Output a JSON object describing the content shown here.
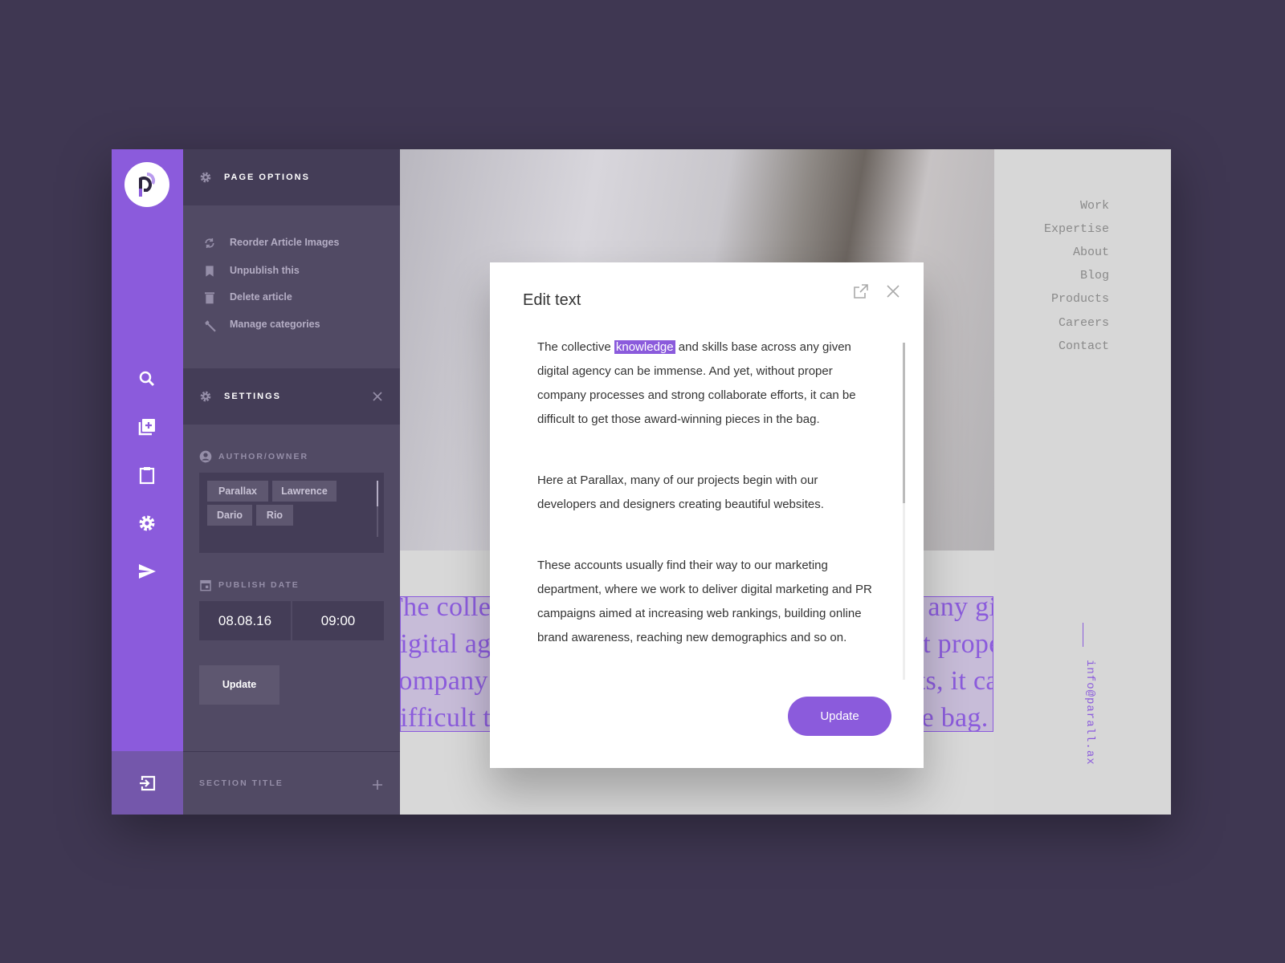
{
  "rail": {
    "brand_color": "#8b5bdc",
    "logo_letter": "P",
    "icons": [
      "search-icon",
      "add-library-icon",
      "clipboard-icon",
      "gear-icon",
      "send-icon"
    ],
    "bottom_icon": "exit-icon"
  },
  "panel": {
    "page_options": {
      "title": "PAGE OPTIONS",
      "items": [
        {
          "label": "Reorder Article Images",
          "icon": "refresh-icon"
        },
        {
          "label": "Unpublish this",
          "icon": "bookmark-icon"
        },
        {
          "label": "Delete article",
          "icon": "trash-icon"
        },
        {
          "label": "Manage categories",
          "icon": "wrench-icon"
        }
      ]
    },
    "settings": {
      "title": "SETTINGS",
      "author_label": "AUTHOR/OWNER",
      "authors": [
        "Parallax",
        "Lawrence",
        "Dario",
        "Rio"
      ],
      "publish_label": "PUBLISH DATE",
      "date": "08.08.16",
      "time": "09:00",
      "update_label": "Update"
    },
    "section_title": "SECTION TITLE"
  },
  "site": {
    "nav": [
      "Work",
      "Expertise",
      "About",
      "Blog",
      "Products",
      "Careers",
      "Contact"
    ],
    "email": "info@parall.ax",
    "headline_lines": [
      "The collective knowledge and skills base across any given",
      "digital agency can be immense. And yet, without proper",
      "company processes and strong collaborate efforts, it can",
      "difficult to get those award-winning pieces in the bag."
    ]
  },
  "modal": {
    "title": "Edit text",
    "p1_before": "The collective ",
    "p1_selected": "knowledge",
    "p1_after": " and skills base across any given digital agency can be immense. And yet, without proper company processes and strong collaborate efforts, it can be difficult to get those award-winning pieces in the bag.",
    "p2": "Here at Parallax, many of our projects begin with our developers and designers creating beautiful websites.",
    "p3": "These accounts usually find their way to our marketing department, where we work to deliver digital marketing and PR campaigns aimed at increasing web rankings, building online brand awareness, reaching new demographics and so on.",
    "update_label": "Update"
  }
}
